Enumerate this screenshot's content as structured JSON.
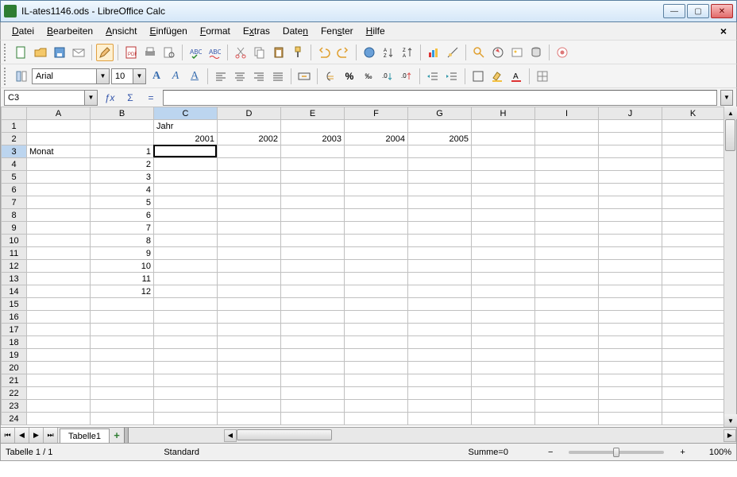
{
  "window": {
    "title": "IL-ates1146.ods - LibreOffice Calc"
  },
  "menu": {
    "items": [
      "Datei",
      "Bearbeiten",
      "Ansicht",
      "Einfügen",
      "Format",
      "Extras",
      "Daten",
      "Fenster",
      "Hilfe"
    ]
  },
  "font": {
    "name": "Arial",
    "size": "10"
  },
  "name_box": "C3",
  "formula": "",
  "columns": [
    "A",
    "B",
    "C",
    "D",
    "E",
    "F",
    "G",
    "H",
    "I",
    "J",
    "K"
  ],
  "rows": 24,
  "active": {
    "col": "C",
    "row": 3
  },
  "cells": {
    "C1": {
      "v": "Jahr",
      "align": "l"
    },
    "C2": {
      "v": "2001"
    },
    "D2": {
      "v": "2002"
    },
    "E2": {
      "v": "2003"
    },
    "F2": {
      "v": "2004"
    },
    "G2": {
      "v": "2005"
    },
    "A3": {
      "v": "Monat",
      "align": "l"
    },
    "B3": {
      "v": "1"
    },
    "B4": {
      "v": "2"
    },
    "B5": {
      "v": "3"
    },
    "B6": {
      "v": "4"
    },
    "B7": {
      "v": "5"
    },
    "B8": {
      "v": "6"
    },
    "B9": {
      "v": "7"
    },
    "B10": {
      "v": "8"
    },
    "B11": {
      "v": "9"
    },
    "B12": {
      "v": "10"
    },
    "B13": {
      "v": "11"
    },
    "B14": {
      "v": "12"
    }
  },
  "sheet_tab": "Tabelle1",
  "status": {
    "sheet_pos": "Tabelle 1 / 1",
    "style": "Standard",
    "sum": "Summe=0",
    "zoom": "100%",
    "zoom_minus": "−",
    "zoom_plus": "+"
  },
  "icons": {
    "bold": "A",
    "italic": "A",
    "underline": "A",
    "fx": "ƒx",
    "sigma": "Σ",
    "eq": "=",
    "percent": "%",
    "currency": "‰",
    "dropdown": "▾"
  }
}
